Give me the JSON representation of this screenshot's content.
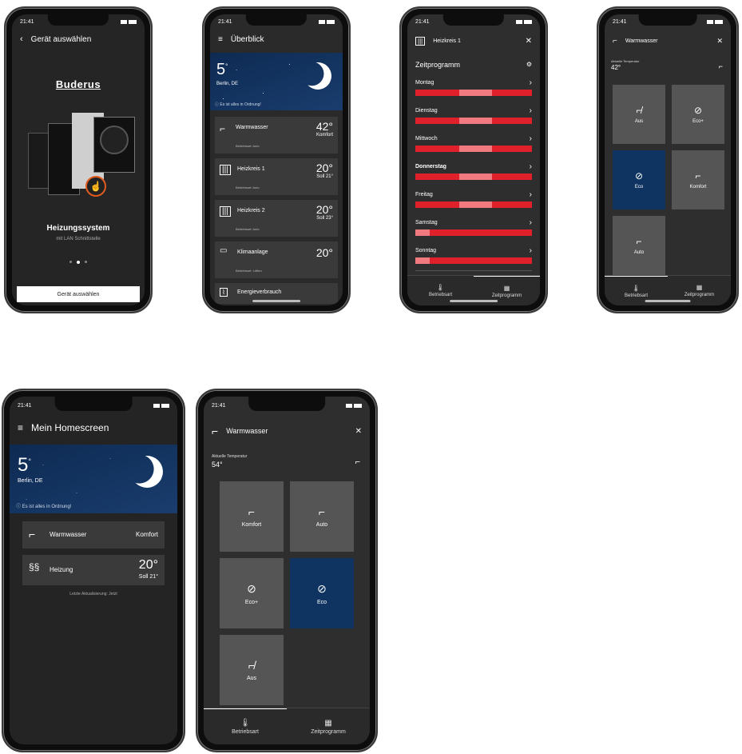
{
  "status_time": "21:41",
  "p1": {
    "title": "Gerät auswählen",
    "brand": "Buderus",
    "device_name": "Heizungssystem",
    "device_sub": "mit LAN Schnittstelle",
    "button": "Gerät auswählen"
  },
  "p2": {
    "title": "Überblick",
    "temp": "5",
    "location": "Berlin, DE",
    "status": "Es ist alles in Ordnung!",
    "cards": [
      {
        "name": "Warmwasser",
        "value": "42°",
        "sub": "Komfort",
        "mode": "Betriebsart: Auto"
      },
      {
        "name": "Heizkreis 1",
        "value": "20°",
        "sub": "Soll 21°",
        "mode": "Betriebsart: Auto"
      },
      {
        "name": "Heizkreis 2",
        "value": "20°",
        "sub": "Soll 23°",
        "mode": "Betriebsart: Auto"
      },
      {
        "name": "Klimaanlage",
        "value": "20°",
        "sub": "",
        "mode": "Betriebsart: Lüften"
      },
      {
        "name": "Energieverbrauch",
        "value": "",
        "sub": "",
        "mode": ""
      }
    ]
  },
  "p3": {
    "title": "Heizkreis 1",
    "subtitle": "Zeitprogramm",
    "days": [
      "Montag",
      "Dienstag",
      "Mittwoch",
      "Donnerstag",
      "Freitag",
      "Samstag",
      "Sonntag"
    ],
    "tab1": "Betriebsart",
    "tab2": "Zeitprogramm"
  },
  "p4": {
    "title": "Warmwasser",
    "temp_label": "Aktuelle Temperatur",
    "temp": "42°",
    "tiles": [
      "Aus",
      "Eco+",
      "Eco",
      "Komfort",
      "Auto"
    ],
    "tab1": "Betriebsart",
    "tab2": "Zeitprogramm"
  },
  "p5": {
    "title": "Mein Homescreen",
    "temp": "5",
    "location": "Berlin, DE",
    "status": "Es ist alles in Ordnung!",
    "card1_name": "Warmwasser",
    "card1_value": "Komfort",
    "card2_name": "Heizung",
    "card2_value": "20°",
    "card2_sub": "Soll 21°",
    "last_update": "Letzte Aktualisierung: Jetzt"
  },
  "p6": {
    "title": "Warmwasser",
    "temp_label": "Aktuelle Temperatur",
    "temp": "54°",
    "tiles": [
      "Komfort",
      "Auto",
      "Eco+",
      "Eco",
      "Aus"
    ],
    "tab1": "Betriebsart",
    "tab2": "Zeitprogramm"
  }
}
